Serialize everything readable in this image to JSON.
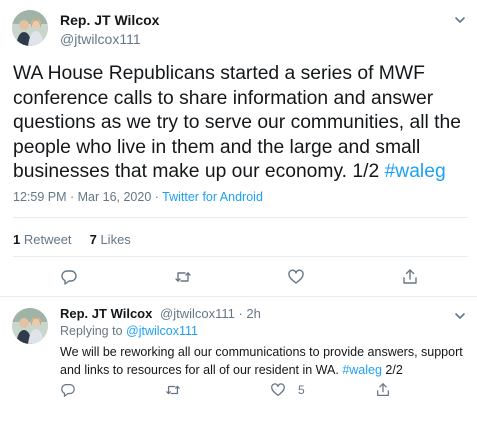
{
  "main_tweet": {
    "author_name": "Rep. JT Wilcox",
    "author_handle": "@jtwilcox111",
    "text": "WA House Republicans started a series of MWF conference calls to share information and answer questions as we try to serve our communities, all the people who live in them and the large and small businesses that make up our economy.  1/2 ",
    "hashtag": "#waleg",
    "time": "12:59 PM · Mar 16, 2020 · ",
    "source": "Twitter for Android",
    "retweets_count": "1",
    "retweets_label": " Retweet",
    "likes_count": "7",
    "likes_label": " Likes"
  },
  "reply_tweet": {
    "author_name": "Rep. JT Wilcox",
    "author_handle": "@jtwilcox111 · 2h",
    "replying_prefix": "Replying to ",
    "replying_to": "@jtwilcox111",
    "text": "We will be reworking all our communications to provide answers, support and links to resources for all of our resident in WA. ",
    "hashtag": "#waleg",
    "text_suffix": " 2/2",
    "like_count": "5"
  },
  "icons": [
    "chevron-down-icon",
    "reply-icon",
    "retweet-icon",
    "like-icon",
    "share-icon"
  ],
  "colors": {
    "accent": "#1da1f2",
    "text": "#14171a",
    "secondary_text": "#657786",
    "divider": "#e6ecf0"
  }
}
